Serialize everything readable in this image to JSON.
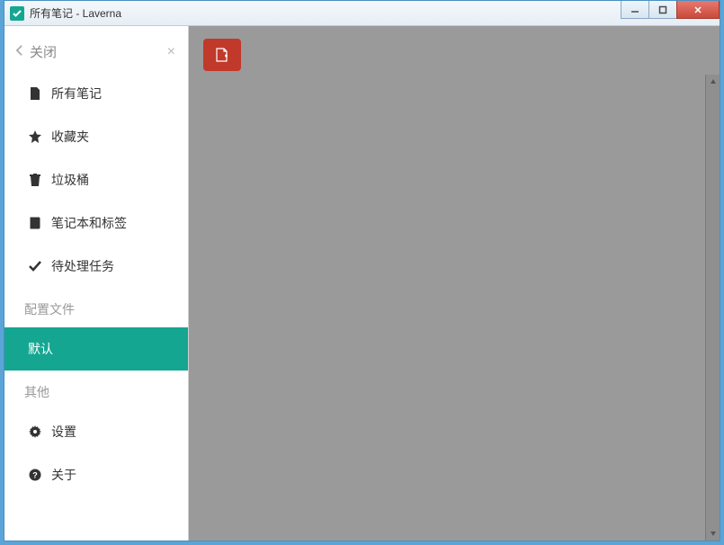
{
  "window": {
    "title": "所有笔记 - Laverna"
  },
  "sidebar": {
    "close_label": "关闭",
    "nav": [
      {
        "icon": "file",
        "label": "所有笔记"
      },
      {
        "icon": "star",
        "label": "收藏夹"
      },
      {
        "icon": "trash",
        "label": "垃圾桶"
      },
      {
        "icon": "book",
        "label": "笔记本和标签"
      },
      {
        "icon": "check",
        "label": "待处理任务"
      }
    ],
    "section_profiles": "配置文件",
    "profile_default": "默认",
    "section_other": "其他",
    "other": [
      {
        "icon": "gear",
        "label": "设置"
      },
      {
        "icon": "question",
        "label": "关于"
      }
    ]
  }
}
